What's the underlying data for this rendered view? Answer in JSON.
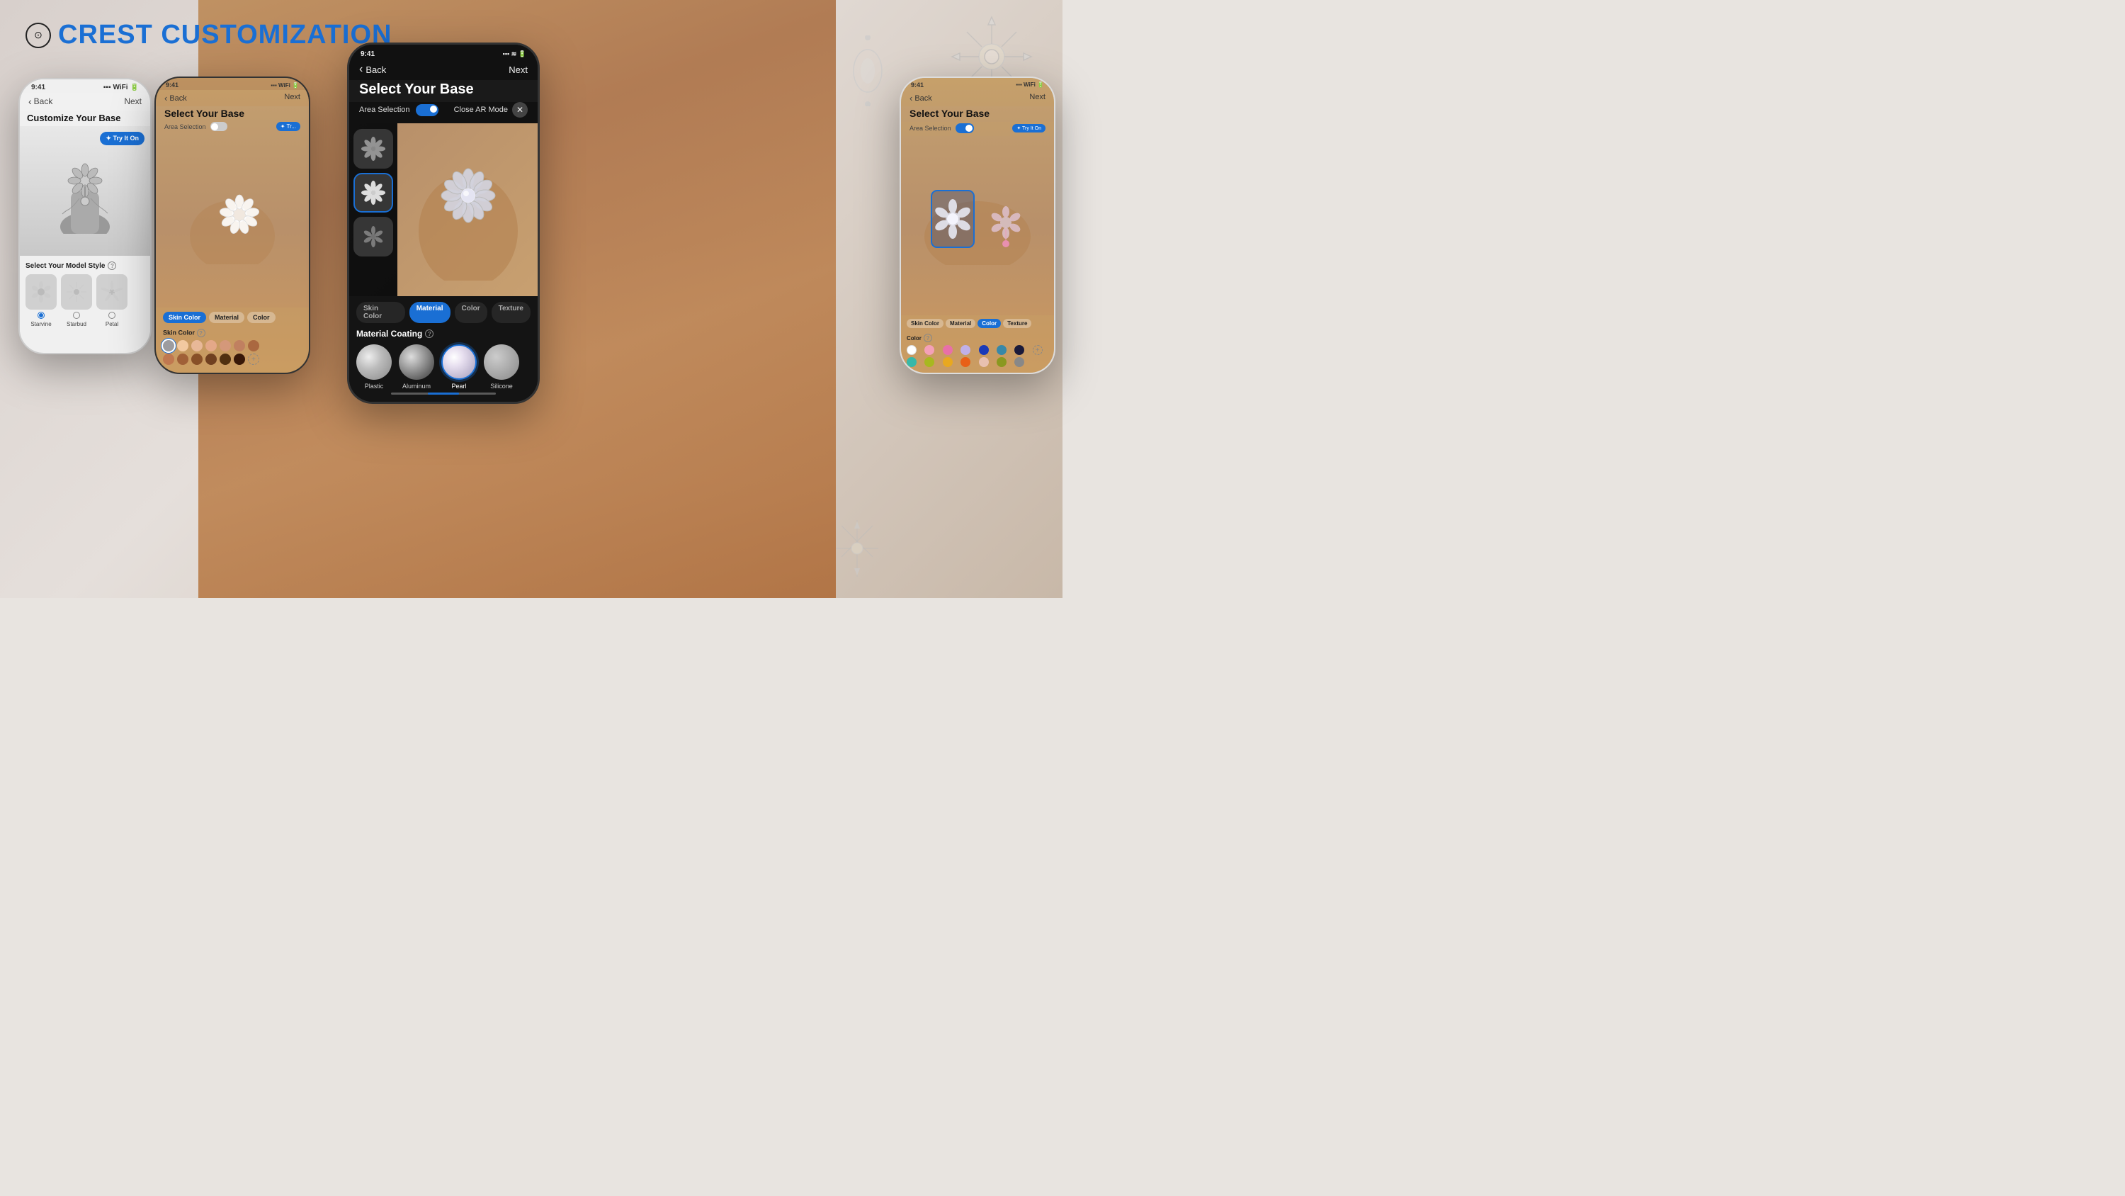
{
  "app": {
    "title_prefix": "CREST CUSTOMIZ",
    "title_suffix": "ATION",
    "logo_symbol": "⊙"
  },
  "phone1": {
    "status_time": "9:41",
    "nav_back": "Back",
    "nav_next": "Next",
    "page_title": "Customize Your Base",
    "try_on_label": "✦ Try It On",
    "section_title": "Select Your Model Style",
    "models": [
      {
        "name": "Starvine",
        "selected": true
      },
      {
        "name": "Starbud",
        "selected": false
      },
      {
        "name": "Petal",
        "selected": false
      }
    ]
  },
  "phone2": {
    "status_time": "9:41",
    "nav_back": "Back",
    "nav_next": "Next",
    "page_title": "Select Your Base",
    "area_selection": "Area Selection",
    "tabs": [
      "Skin Color",
      "Material",
      "Color"
    ],
    "active_tab": "Skin Color",
    "skin_color_label": "Skin Color",
    "skin_colors_row1": [
      "#9c9ca0",
      "#f2c9a0",
      "#e8b898",
      "#e4a888",
      "#d4987a",
      "#c08060"
    ],
    "skin_colors_row2": [
      "#c07850",
      "#a06038",
      "#885028",
      "#704020",
      "#503010",
      "#381808"
    ]
  },
  "phone3": {
    "status_time": "9:41",
    "nav_back": "Back",
    "nav_next": "Next",
    "page_title": "Select Your Base",
    "area_selection": "Area Selection",
    "area_toggle": true,
    "close_ar": "Close AR Mode",
    "tabs": [
      "Skin Color",
      "Material",
      "Color",
      "Texture"
    ],
    "active_tab": "Material",
    "material_coating_label": "Material Coating",
    "materials": [
      {
        "name": "Plastic",
        "type": "plastic"
      },
      {
        "name": "Aluminum",
        "type": "aluminum"
      },
      {
        "name": "Pearl",
        "type": "pearl",
        "selected": true
      },
      {
        "name": "Silicone",
        "type": "silicone"
      }
    ]
  },
  "phone4": {
    "status_time": "9:41",
    "nav_back": "Back",
    "nav_next": "Next",
    "page_title": "Select Your Base",
    "area_selection": "Area Selection",
    "area_toggle": true,
    "try_on_label": "✦ Try It On",
    "tabs": [
      "Skin Color",
      "Material",
      "Color",
      "Texture"
    ],
    "active_tab": "Color",
    "color_label": "Color",
    "colors_row1": [
      "#ffffff",
      "#f4a0b8",
      "#e870a8",
      "#c0b0e8",
      "#1a3ab8",
      "#3888a8",
      "#1a1a3a"
    ],
    "colors_row2": [
      "#38b8a8",
      "#a8b820",
      "#e8a820",
      "#e86018",
      "#e8c0b0",
      "#8a9820",
      "#888888"
    ]
  }
}
